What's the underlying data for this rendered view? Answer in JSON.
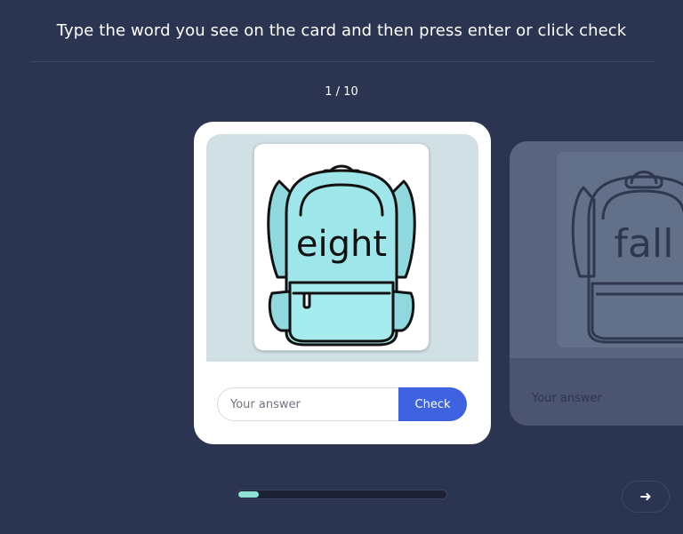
{
  "header": {
    "instruction": "Type the word you see on the card and then press enter or click check",
    "counter": "1 / 10"
  },
  "current_card": {
    "word": "eight",
    "image_icon": "backpack-icon",
    "answer_placeholder": "Your answer",
    "answer_value": "",
    "check_label": "Check"
  },
  "next_card": {
    "word": "fall",
    "image_icon": "backpack-icon",
    "answer_placeholder": "Your answer"
  },
  "progress": {
    "fraction": 0.1
  },
  "navigation": {
    "next_icon": "arrow-right-icon"
  },
  "colors": {
    "background": "#2b3450",
    "backpack_fill": "#9fe6ea",
    "check_button": "#3f63e0",
    "progress_fill": "#8fe3d4"
  }
}
